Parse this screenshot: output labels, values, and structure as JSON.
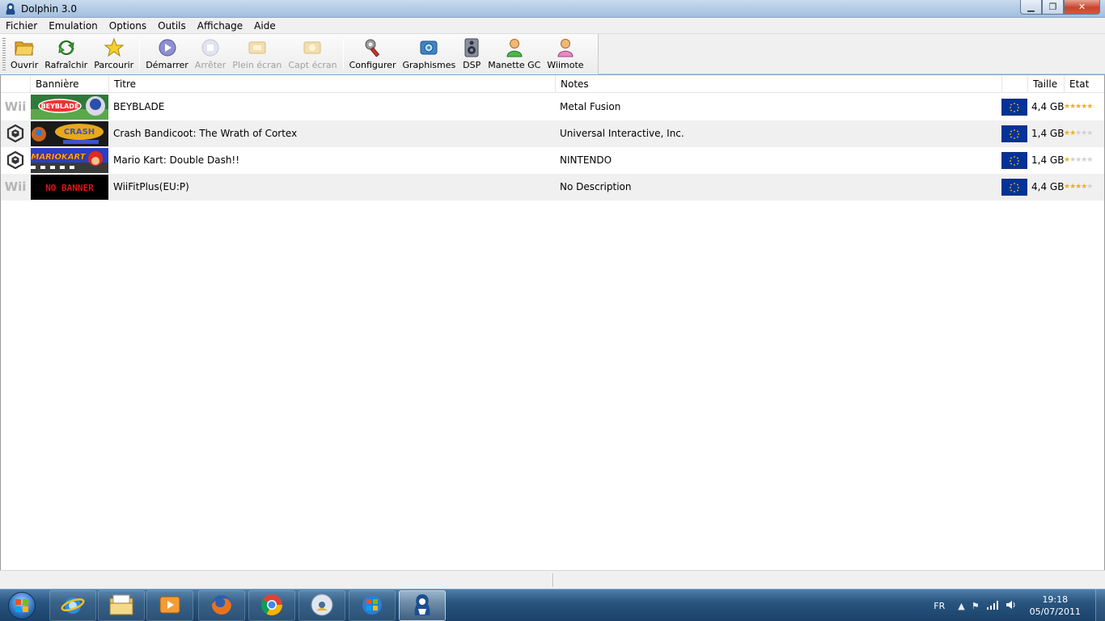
{
  "window": {
    "title": "Dolphin 3.0"
  },
  "menu": [
    "Fichier",
    "Emulation",
    "Options",
    "Outils",
    "Affichage",
    "Aide"
  ],
  "toolbar": {
    "open": "Ouvrir",
    "refresh": "Rafraîchir",
    "browse": "Parcourir",
    "play": "Démarrer",
    "stop": "Arrêter",
    "fullscreen": "Plein écran",
    "screenshot": "Capt écran",
    "config": "Configurer",
    "graphics": "Graphismes",
    "dsp": "DSP",
    "gcpad": "Manette GC",
    "wiimote": "Wiimote"
  },
  "columns": {
    "banner": "Bannière",
    "title": "Titre",
    "notes": "Notes",
    "size": "Taille",
    "state": "Etat"
  },
  "games": [
    {
      "platform": "Wii",
      "title": "BEYBLADE",
      "notes": "Metal Fusion",
      "region": "EU",
      "size": "4,4 GB",
      "rating": 5
    },
    {
      "platform": "GameCube",
      "title": "Crash Bandicoot: The Wrath of Cortex",
      "notes": "Universal Interactive, Inc.",
      "region": "EU",
      "size": "1,4 GB",
      "rating": 2
    },
    {
      "platform": "GameCube",
      "title": "Mario Kart: Double Dash!!",
      "notes": "NINTENDO",
      "region": "EU",
      "size": "1,4 GB",
      "rating": 1
    },
    {
      "platform": "Wii",
      "title": "WiiFitPlus(EU:P)",
      "notes": "No Description",
      "region": "EU",
      "size": "4,4 GB",
      "rating": 4
    }
  ],
  "banners": {
    "beyblade": "BEYBLADE",
    "crash": "CRASH",
    "mariokart": "MARIOKART",
    "nobanner": "NO BANNER"
  },
  "platform_labels": {
    "wii": "Wii"
  },
  "taskbar": {
    "language": "FR",
    "time": "19:18",
    "date": "05/07/2011"
  },
  "colors": {
    "eu_flag": "#003399",
    "star": "#e8b41a",
    "row_alt": "#f0f0f0"
  }
}
